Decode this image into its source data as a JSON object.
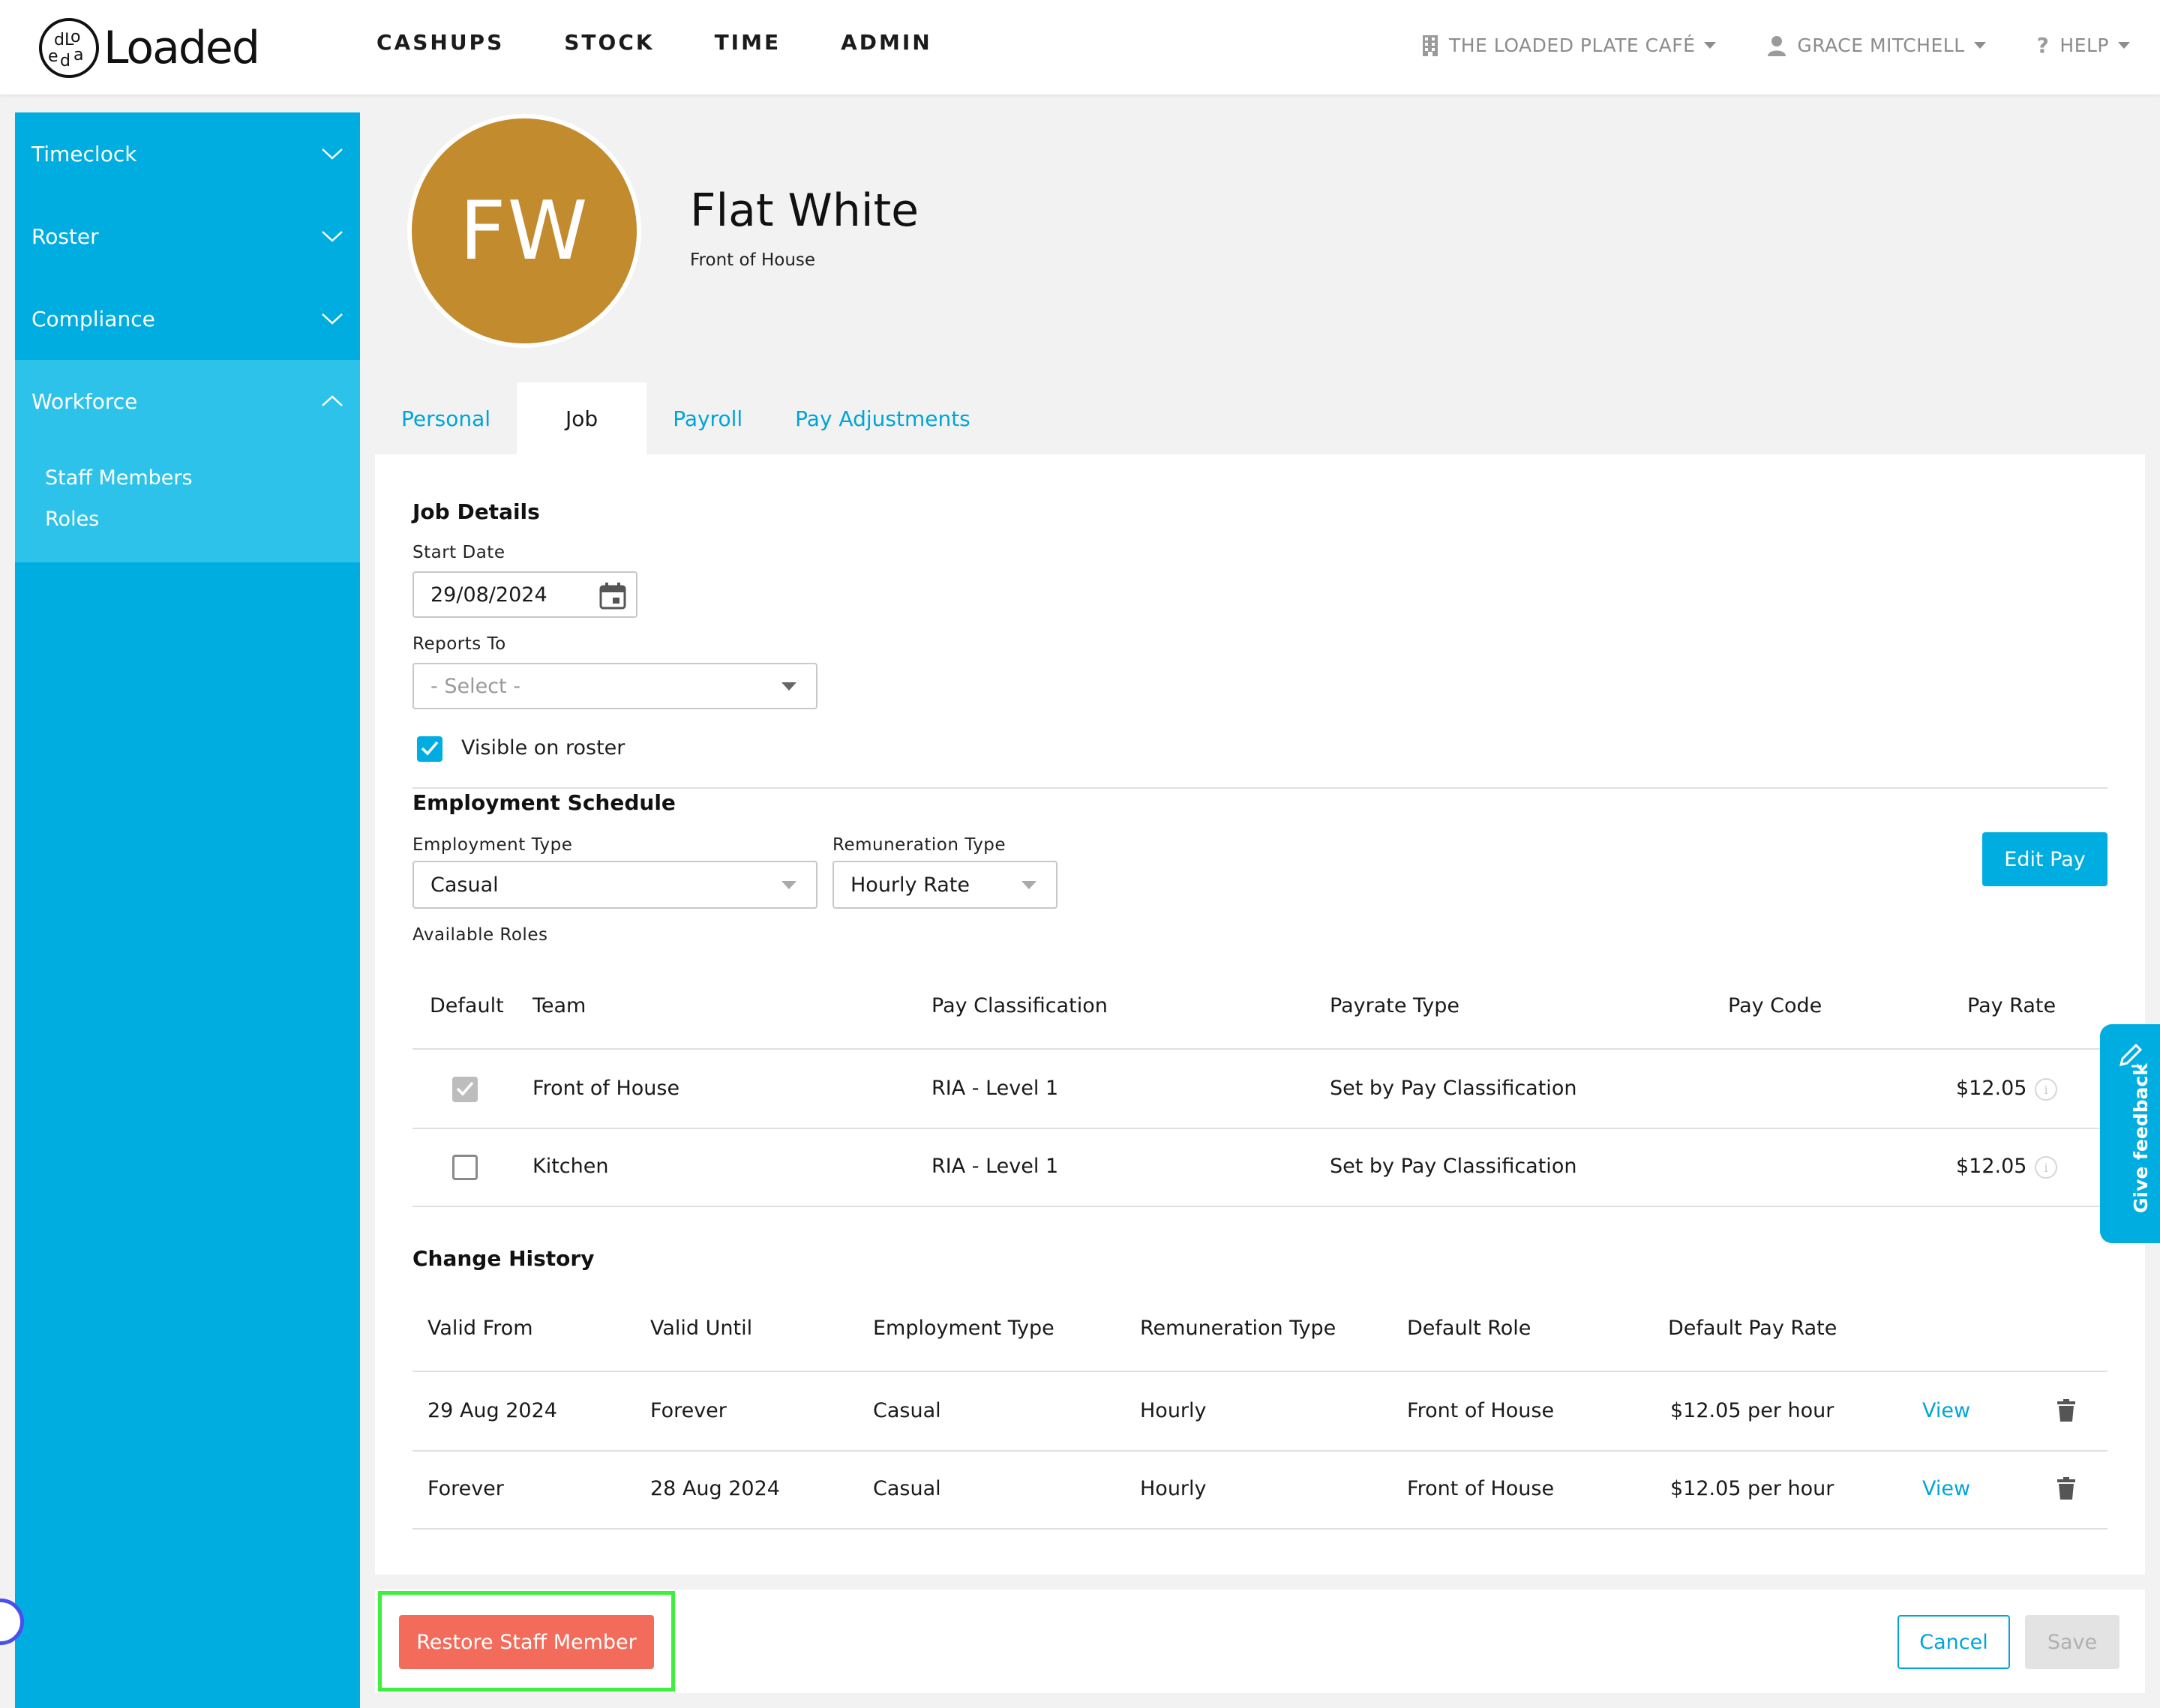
{
  "brand": {
    "name": "Loaded",
    "mark": "dLoeda"
  },
  "nav": {
    "items": [
      "CASHUPS",
      "STOCK",
      "TIME",
      "ADMIN"
    ]
  },
  "account": {
    "venue": "THE LOADED PLATE CAFÉ",
    "user": "GRACE MITCHELL",
    "help": "HELP"
  },
  "sidebar": {
    "items": [
      {
        "label": "Timeclock",
        "expanded": false
      },
      {
        "label": "Roster",
        "expanded": false
      },
      {
        "label": "Compliance",
        "expanded": false
      },
      {
        "label": "Workforce",
        "expanded": true
      }
    ],
    "subitems": [
      "Staff Members",
      "Roles"
    ]
  },
  "profile": {
    "initials": "FW",
    "name": "Flat White",
    "team": "Front of House",
    "avatar_color": "#c28b2e"
  },
  "tabs": [
    "Personal",
    "Job",
    "Payroll",
    "Pay Adjustments"
  ],
  "active_tab": "Job",
  "job": {
    "section_title": "Job Details",
    "start_date_label": "Start Date",
    "start_date": "29/08/2024",
    "reports_to_label": "Reports To",
    "reports_to_placeholder": "- Select -",
    "visible_on_roster_label": "Visible on roster",
    "visible_on_roster": true
  },
  "schedule": {
    "section_title": "Employment Schedule",
    "employment_type_label": "Employment Type",
    "employment_type": "Casual",
    "remuneration_type_label": "Remuneration Type",
    "remuneration_type": "Hourly Rate",
    "edit_pay_label": "Edit Pay",
    "available_roles_label": "Available Roles"
  },
  "roles_table": {
    "headers": [
      "Default",
      "Team",
      "Pay Classification",
      "Payrate Type",
      "Pay Code",
      "Pay Rate"
    ],
    "rows": [
      {
        "default": true,
        "team": "Front of House",
        "classification": "RIA - Level 1",
        "payrate_type": "Set by Pay Classification",
        "pay_code": "",
        "pay_rate": "$12.05"
      },
      {
        "default": false,
        "team": "Kitchen",
        "classification": "RIA - Level 1",
        "payrate_type": "Set by Pay Classification",
        "pay_code": "",
        "pay_rate": "$12.05"
      }
    ]
  },
  "history": {
    "section_title": "Change History",
    "headers": [
      "Valid From",
      "Valid Until",
      "Employment Type",
      "Remuneration Type",
      "Default Role",
      "Default Pay Rate"
    ],
    "view_label": "View",
    "rows": [
      {
        "valid_from": "29 Aug 2024",
        "valid_until": "Forever",
        "employment_type": "Casual",
        "remuneration_type": "Hourly",
        "default_role": "Front of House",
        "default_pay_rate": "$12.05 per hour"
      },
      {
        "valid_from": "Forever",
        "valid_until": "28 Aug 2024",
        "employment_type": "Casual",
        "remuneration_type": "Hourly",
        "default_role": "Front of House",
        "default_pay_rate": "$12.05 per hour"
      }
    ]
  },
  "footer": {
    "restore_label": "Restore Staff Member",
    "cancel_label": "Cancel",
    "save_label": "Save"
  },
  "feedback": {
    "label": "Give feedback"
  },
  "colors": {
    "accent": "#00ade0",
    "danger": "#f26b5b",
    "highlight": "#3ef03e"
  }
}
